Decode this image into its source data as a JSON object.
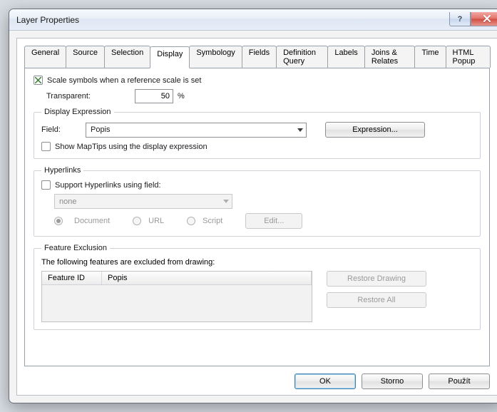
{
  "window": {
    "title": "Layer Properties"
  },
  "tabs": {
    "items": [
      {
        "label": "General"
      },
      {
        "label": "Source"
      },
      {
        "label": "Selection"
      },
      {
        "label": "Display"
      },
      {
        "label": "Symbology"
      },
      {
        "label": "Fields"
      },
      {
        "label": "Definition Query"
      },
      {
        "label": "Labels"
      },
      {
        "label": "Joins & Relates"
      },
      {
        "label": "Time"
      },
      {
        "label": "HTML Popup"
      }
    ],
    "activeIndex": 3
  },
  "display": {
    "scaleSymbolsLabel": "Scale symbols when a reference scale is set",
    "scaleSymbolsChecked": true,
    "transparentLabel": "Transparent:",
    "transparentValue": "50",
    "transparentSuffix": "%",
    "expressionGroup": "Display Expression",
    "fieldLabel": "Field:",
    "fieldValue": "Popis",
    "expressionButton": "Expression...",
    "mapTipsLabel": "Show MapTips using the display expression",
    "mapTipsChecked": false
  },
  "hyperlinks": {
    "group": "Hyperlinks",
    "supportLabel": "Support Hyperlinks using field:",
    "supportChecked": false,
    "fieldValue": "none",
    "radios": {
      "document": "Document",
      "url": "URL",
      "script": "Script"
    },
    "selected": "document",
    "editButton": "Edit..."
  },
  "exclusion": {
    "group": "Feature Exclusion",
    "caption": "The following features are excluded from drawing:",
    "columns": {
      "id": "Feature ID",
      "popis": "Popis"
    },
    "restoreDrawing": "Restore Drawing",
    "restoreAll": "Restore All"
  },
  "buttons": {
    "ok": "OK",
    "cancel": "Storno",
    "apply": "Použít"
  }
}
